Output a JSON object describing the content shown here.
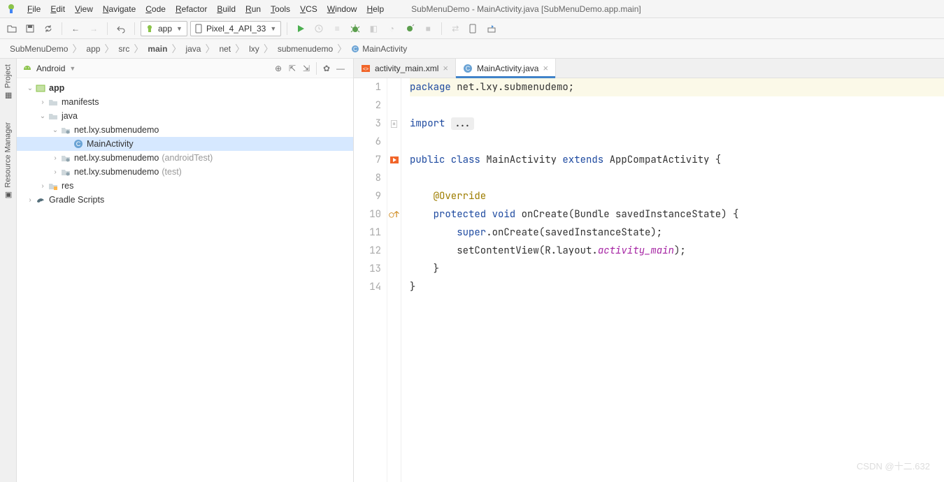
{
  "menu": {
    "items": [
      "File",
      "Edit",
      "View",
      "Navigate",
      "Code",
      "Refactor",
      "Build",
      "Run",
      "Tools",
      "VCS",
      "Window",
      "Help"
    ],
    "title": "SubMenuDemo - MainActivity.java [SubMenuDemo.app.main]"
  },
  "toolbar": {
    "run_config": "app",
    "device": "Pixel_4_API_33"
  },
  "breadcrumb": {
    "segments": [
      "SubMenuDemo",
      "app",
      "src",
      "main",
      "java",
      "net",
      "lxy",
      "submenudemo",
      "MainActivity"
    ],
    "bold_index": 3
  },
  "left_tabs": {
    "project": "Project",
    "resmgr": "Resource Manager"
  },
  "project_panel": {
    "title": "Android",
    "tree": [
      {
        "depth": 0,
        "arrow": "down",
        "icon": "module",
        "label": "app",
        "bold": true
      },
      {
        "depth": 1,
        "arrow": "right",
        "icon": "folder",
        "label": "manifests"
      },
      {
        "depth": 1,
        "arrow": "down",
        "icon": "folder",
        "label": "java"
      },
      {
        "depth": 2,
        "arrow": "down",
        "icon": "package",
        "label": "net.lxy.submenudemo"
      },
      {
        "depth": 3,
        "arrow": "",
        "icon": "class",
        "label": "MainActivity",
        "selected": true
      },
      {
        "depth": 2,
        "arrow": "right",
        "icon": "package",
        "label": "net.lxy.submenudemo",
        "suffix": "(androidTest)"
      },
      {
        "depth": 2,
        "arrow": "right",
        "icon": "package",
        "label": "net.lxy.submenudemo",
        "suffix": "(test)"
      },
      {
        "depth": 1,
        "arrow": "right",
        "icon": "resfolder",
        "label": "res"
      },
      {
        "depth": 0,
        "arrow": "right",
        "icon": "gradle",
        "label": "Gradle Scripts"
      }
    ]
  },
  "tabs": [
    {
      "icon": "xml",
      "label": "activity_main.xml",
      "active": false
    },
    {
      "icon": "class",
      "label": "MainActivity.java",
      "active": true
    }
  ],
  "code": {
    "lines": [
      {
        "n": 1,
        "hl": true,
        "tokens": [
          [
            "kw",
            "package "
          ],
          [
            "",
            "net.lxy.submenudemo;"
          ]
        ]
      },
      {
        "n": 2,
        "tokens": [
          [
            "",
            ""
          ]
        ]
      },
      {
        "n": 3,
        "fold": "plus",
        "tokens": [
          [
            "kw",
            "import "
          ],
          [
            "imp-dots",
            "..."
          ]
        ]
      },
      {
        "n": 6,
        "tokens": [
          [
            "",
            ""
          ]
        ]
      },
      {
        "n": 7,
        "mark": "run",
        "tokens": [
          [
            "kw",
            "public class "
          ],
          [
            "cls",
            "MainActivity "
          ],
          [
            "kw",
            "extends "
          ],
          [
            "",
            "AppCompatActivity {"
          ]
        ]
      },
      {
        "n": 8,
        "tokens": [
          [
            "",
            ""
          ]
        ]
      },
      {
        "n": 9,
        "tokens": [
          [
            "",
            "    "
          ],
          [
            "ann",
            "@Override"
          ]
        ]
      },
      {
        "n": 10,
        "mark": "override",
        "tokens": [
          [
            "",
            "    "
          ],
          [
            "kw",
            "protected void "
          ],
          [
            "mtd",
            "onCreate"
          ],
          [
            "",
            "(Bundle savedInstanceState) {"
          ]
        ]
      },
      {
        "n": 11,
        "tokens": [
          [
            "",
            "        "
          ],
          [
            "kw",
            "super"
          ],
          [
            "",
            ".onCreate(savedInstanceState);"
          ]
        ]
      },
      {
        "n": 12,
        "tokens": [
          [
            "",
            "        setContentView(R.layout."
          ],
          [
            "id-i",
            "activity_main"
          ],
          [
            "",
            ");"
          ]
        ]
      },
      {
        "n": 13,
        "tokens": [
          [
            "",
            "    }"
          ]
        ]
      },
      {
        "n": 14,
        "tokens": [
          [
            "",
            "}"
          ]
        ]
      }
    ]
  },
  "watermark": "CSDN @十二.632"
}
